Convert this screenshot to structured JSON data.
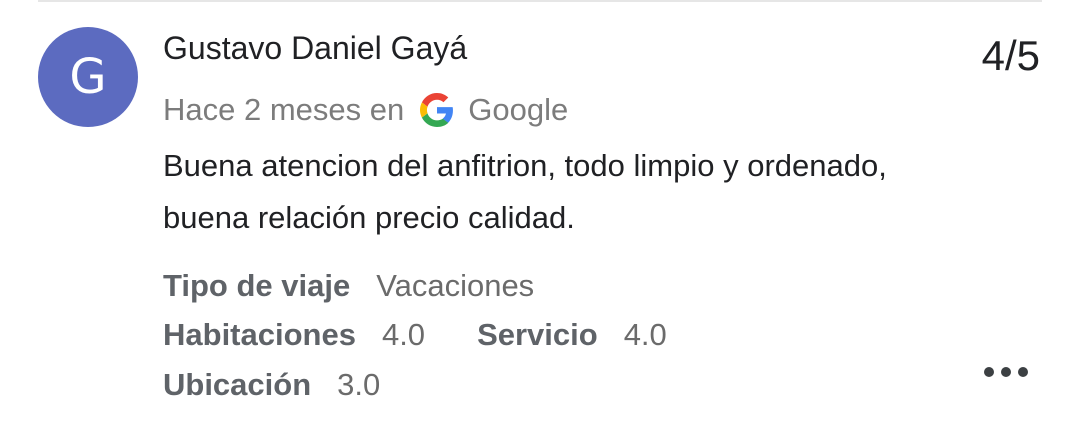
{
  "review": {
    "avatar_initial": "G",
    "author": "Gustavo Daniel Gayá",
    "rating": "4/5",
    "time_ago": "Hace 2 meses en",
    "source": "Google",
    "text": "Buena atencion del anfitrion, todo limpio y ordenado, buena relación precio calidad.",
    "attributes": {
      "trip_type_label": "Tipo de viaje",
      "trip_type_value": "Vacaciones",
      "rooms_label": "Habitaciones",
      "rooms_value": "4.0",
      "service_label": "Servicio",
      "service_value": "4.0",
      "location_label": "Ubicación",
      "location_value": "3.0"
    }
  },
  "colors": {
    "avatar_bg": "#5c6bc0",
    "text_primary": "#202124",
    "text_secondary": "#7c7c7c"
  },
  "icons": {
    "source_logo": "google-g-icon",
    "more": "more-horiz-icon"
  }
}
